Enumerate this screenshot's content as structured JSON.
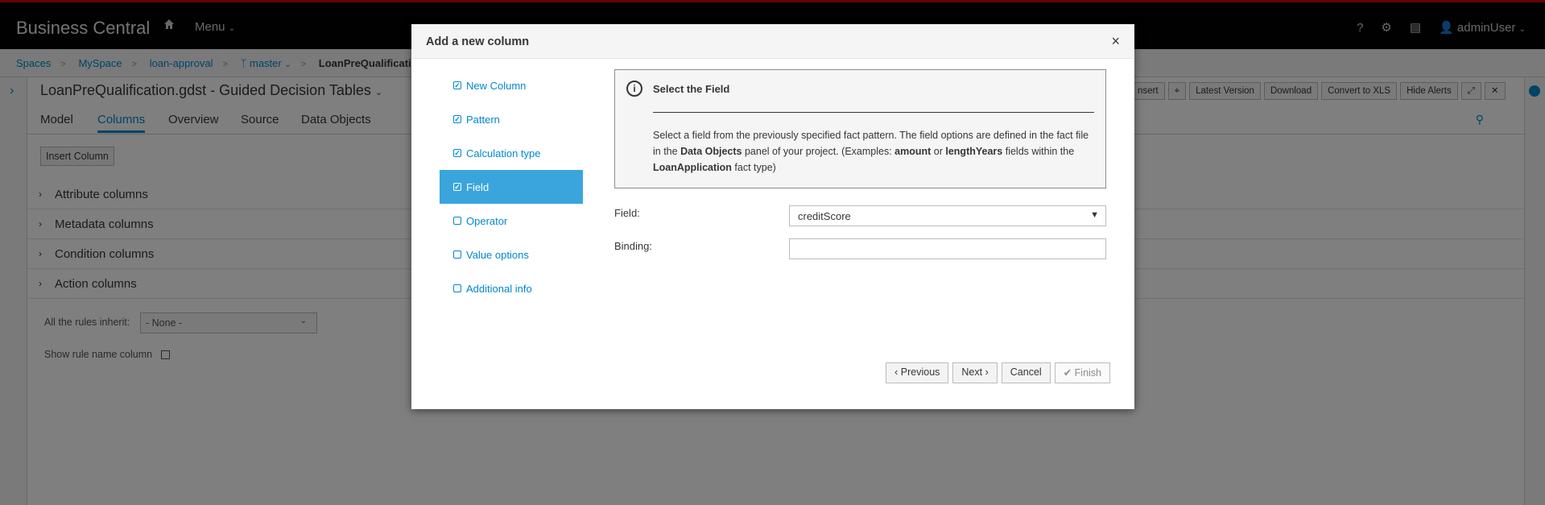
{
  "app": {
    "brand": "Business Central",
    "menu_label": "Menu",
    "help": "?",
    "user": "adminUser"
  },
  "breadcrumb": {
    "items": [
      "Spaces",
      "MySpace",
      "loan-approval",
      "master"
    ],
    "current": "LoanPreQualification"
  },
  "editor": {
    "title": "LoanPreQualification.gdst - Guided Decision Tables",
    "toolbar": [
      "nsert",
      "Latest Version",
      "Download",
      "Convert to XLS",
      "Hide Alerts"
    ],
    "tabs": [
      "Model",
      "Columns",
      "Overview",
      "Source",
      "Data Objects"
    ],
    "active_tab": "Columns",
    "insert_button": "Insert Column",
    "column_groups": [
      "Attribute columns",
      "Metadata columns",
      "Condition columns",
      "Action columns"
    ],
    "inherit_label": "All the rules inherit:",
    "inherit_value": "- None -",
    "show_rule_label": "Show rule name column"
  },
  "modal": {
    "title": "Add a new column",
    "close": "×",
    "steps": [
      {
        "label": "New Column",
        "done": true
      },
      {
        "label": "Pattern",
        "done": true
      },
      {
        "label": "Calculation type",
        "done": true
      },
      {
        "label": "Field",
        "done": true
      },
      {
        "label": "Operator",
        "done": false
      },
      {
        "label": "Value options",
        "done": false
      },
      {
        "label": "Additional info",
        "done": false
      }
    ],
    "active_step": "Field",
    "info": {
      "title": "Select the Field",
      "text_1": "Select a field from the previously specified fact pattern. The field options are defined in the fact file in the ",
      "bold_1": "Data Objects",
      "text_2": " panel of your project. (Examples: ",
      "bold_2": "amount",
      "text_3": " or ",
      "bold_3": "lengthYears",
      "text_4": " fields within the ",
      "bold_4": "LoanApplication",
      "text_5": " fact type)"
    },
    "field_label": "Field:",
    "field_value": "creditScore",
    "binding_label": "Binding:",
    "binding_value": "",
    "buttons": {
      "previous": "Previous",
      "next": "Next",
      "cancel": "Cancel",
      "finish": "Finish"
    }
  }
}
